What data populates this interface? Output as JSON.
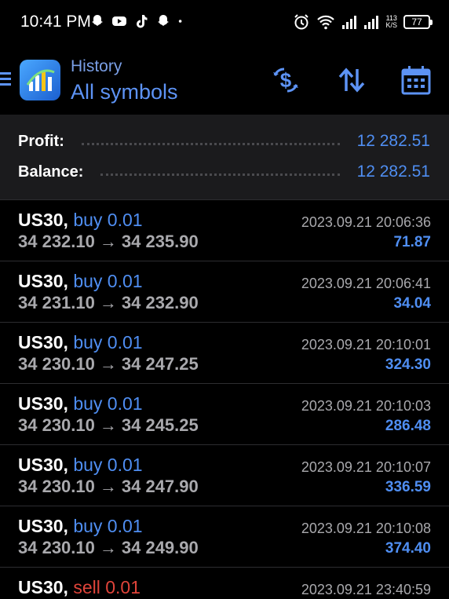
{
  "status_bar": {
    "time": "10:41 PM",
    "app_icons": [
      "snapchat-icon",
      "youtube-icon",
      "tiktok-icon",
      "snapchat-icon"
    ],
    "net_speed_value": "113",
    "net_speed_unit": "K/S",
    "battery": "77"
  },
  "header": {
    "title": "History",
    "subtitle": "All symbols",
    "actions": [
      "currency-exchange-icon",
      "sort-icon",
      "calendar-icon"
    ]
  },
  "summary": {
    "profit_label": "Profit:",
    "profit_value": "12 282.51",
    "balance_label": "Balance:",
    "balance_value": "12 282.51"
  },
  "trades": [
    {
      "symbol": "US30,",
      "side": "buy 0.01",
      "open": "34 232.10",
      "arrow": "→",
      "close": "34 235.90",
      "time": "2023.09.21 20:06:36",
      "profit": "71.87"
    },
    {
      "symbol": "US30,",
      "side": "buy 0.01",
      "open": "34 231.10",
      "arrow": "→",
      "close": "34 232.90",
      "time": "2023.09.21 20:06:41",
      "profit": "34.04"
    },
    {
      "symbol": "US30,",
      "side": "buy 0.01",
      "open": "34 230.10",
      "arrow": "→",
      "close": "34 247.25",
      "time": "2023.09.21 20:10:01",
      "profit": "324.30"
    },
    {
      "symbol": "US30,",
      "side": "buy 0.01",
      "open": "34 230.10",
      "arrow": "→",
      "close": "34 245.25",
      "time": "2023.09.21 20:10:03",
      "profit": "286.48"
    },
    {
      "symbol": "US30,",
      "side": "buy 0.01",
      "open": "34 230.10",
      "arrow": "→",
      "close": "34 247.90",
      "time": "2023.09.21 20:10:07",
      "profit": "336.59"
    },
    {
      "symbol": "US30,",
      "side": "buy 0.01",
      "open": "34 230.10",
      "arrow": "→",
      "close": "34 249.90",
      "time": "2023.09.21 20:10:08",
      "profit": "374.40"
    },
    {
      "symbol": "US30,",
      "side": "sell 0.01",
      "open": "",
      "arrow": "",
      "close": "",
      "time": "2023.09.21 23:40:59",
      "profit": ""
    }
  ],
  "colors": {
    "accent": "#4f8ef2",
    "sell": "#e0443a",
    "summary_bg": "#1b1b1d",
    "muted": "#a9a9ad"
  }
}
